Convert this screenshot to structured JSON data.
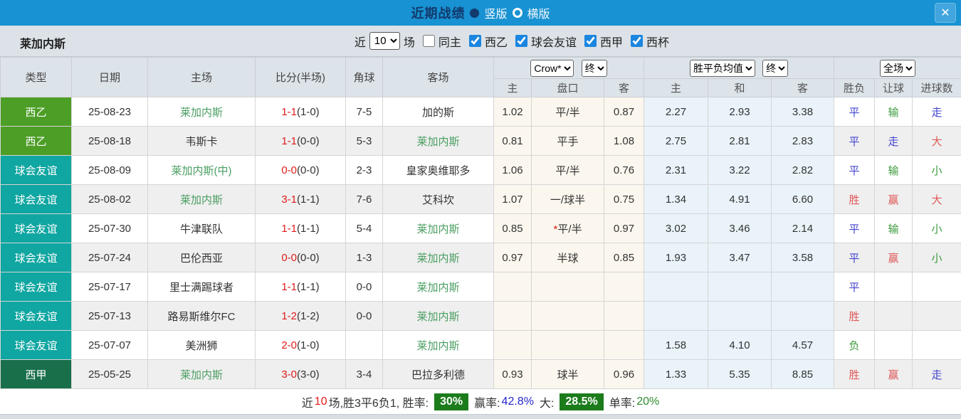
{
  "titlebar": {
    "title": "近期战绩",
    "radio_vertical": "竖版",
    "radio_horizontal": "横版",
    "close": "✕"
  },
  "filters": {
    "team": "莱加内斯",
    "near_label": "近",
    "matches_value": "10",
    "matches_unit": "场",
    "same_home_label": "同主",
    "league_xiyi": "西乙",
    "league_friendly": "球会友谊",
    "league_xijia": "西甲",
    "league_xibei": "西杯"
  },
  "table": {
    "headers": [
      "类型",
      "日期",
      "主场",
      "比分(半场)",
      "角球",
      "客场"
    ],
    "controls": {
      "odds_source": "Crow*",
      "final1": "终",
      "avg_label": "胜平负均值",
      "final2": "终",
      "scope": "全场"
    },
    "sub_headers": [
      "主",
      "盘口",
      "客",
      "主",
      "和",
      "客",
      "胜负",
      "让球",
      "进球数"
    ],
    "rows": [
      {
        "row_class": "",
        "type": "西乙",
        "type_class": "lg-xiyi",
        "date": "25-08-23",
        "home": "莱加内斯",
        "home_class": "t-green",
        "score": "1-1",
        "half": "(1-0)",
        "corner": "7-5",
        "away": "加的斯",
        "away_class": "",
        "hcap_home": "1.02",
        "hcap_star": "",
        "hcap": "平/半",
        "hcap_away": "0.87",
        "avg_home": "2.27",
        "avg_draw": "2.93",
        "avg_away": "3.38",
        "res_wdl": "平",
        "res_wdl_class": "c-blue",
        "res_hcap": "输",
        "res_hcap_class": "c-green",
        "res_goals": "走",
        "res_goals_class": "c-blue"
      },
      {
        "row_class": "alt",
        "type": "西乙",
        "type_class": "lg-xiyi",
        "date": "25-08-18",
        "home": "韦斯卡",
        "home_class": "",
        "score": "1-1",
        "half": "(0-0)",
        "corner": "5-3",
        "away": "莱加内斯",
        "away_class": "t-green",
        "hcap_home": "0.81",
        "hcap_star": "",
        "hcap": "平手",
        "hcap_away": "1.08",
        "avg_home": "2.75",
        "avg_draw": "2.81",
        "avg_away": "2.83",
        "res_wdl": "平",
        "res_wdl_class": "c-blue",
        "res_hcap": "走",
        "res_hcap_class": "c-blue",
        "res_goals": "大",
        "res_goals_class": "c-red"
      },
      {
        "row_class": "",
        "type": "球会友谊",
        "type_class": "lg-friend",
        "date": "25-08-09",
        "home": "莱加内斯(中)",
        "home_class": "t-green",
        "score": "0-0",
        "half": "(0-0)",
        "corner": "2-3",
        "away": "皇家奥维耶多",
        "away_class": "",
        "hcap_home": "1.06",
        "hcap_star": "",
        "hcap": "平/半",
        "hcap_away": "0.76",
        "avg_home": "2.31",
        "avg_draw": "3.22",
        "avg_away": "2.82",
        "res_wdl": "平",
        "res_wdl_class": "c-blue",
        "res_hcap": "输",
        "res_hcap_class": "c-green",
        "res_goals": "小",
        "res_goals_class": "c-green"
      },
      {
        "row_class": "alt",
        "type": "球会友谊",
        "type_class": "lg-friend",
        "date": "25-08-02",
        "home": "莱加内斯",
        "home_class": "t-green",
        "score": "3-1",
        "half": "(1-1)",
        "corner": "7-6",
        "away": "艾科坎",
        "away_class": "",
        "hcap_home": "1.07",
        "hcap_star": "",
        "hcap": "一/球半",
        "hcap_away": "0.75",
        "avg_home": "1.34",
        "avg_draw": "4.91",
        "avg_away": "6.60",
        "res_wdl": "胜",
        "res_wdl_class": "c-red",
        "res_hcap": "赢",
        "res_hcap_class": "c-red",
        "res_goals": "大",
        "res_goals_class": "c-red"
      },
      {
        "row_class": "",
        "type": "球会友谊",
        "type_class": "lg-friend",
        "date": "25-07-30",
        "home": "牛津联队",
        "home_class": "",
        "score": "1-1",
        "half": "(1-1)",
        "corner": "5-4",
        "away": "莱加内斯",
        "away_class": "t-green",
        "hcap_home": "0.85",
        "hcap_star": "*",
        "hcap": "平/半",
        "hcap_away": "0.97",
        "avg_home": "3.02",
        "avg_draw": "3.46",
        "avg_away": "2.14",
        "res_wdl": "平",
        "res_wdl_class": "c-blue",
        "res_hcap": "输",
        "res_hcap_class": "c-green",
        "res_goals": "小",
        "res_goals_class": "c-green"
      },
      {
        "row_class": "alt",
        "type": "球会友谊",
        "type_class": "lg-friend",
        "date": "25-07-24",
        "home": "巴伦西亚",
        "home_class": "",
        "score": "0-0",
        "half": "(0-0)",
        "corner": "1-3",
        "away": "莱加内斯",
        "away_class": "t-green",
        "hcap_home": "0.97",
        "hcap_star": "",
        "hcap": "半球",
        "hcap_away": "0.85",
        "avg_home": "1.93",
        "avg_draw": "3.47",
        "avg_away": "3.58",
        "res_wdl": "平",
        "res_wdl_class": "c-blue",
        "res_hcap": "赢",
        "res_hcap_class": "c-red",
        "res_goals": "小",
        "res_goals_class": "c-green"
      },
      {
        "row_class": "",
        "type": "球会友谊",
        "type_class": "lg-friend",
        "date": "25-07-17",
        "home": "里士满踢球者",
        "home_class": "",
        "score": "1-1",
        "half": "(1-1)",
        "corner": "0-0",
        "away": "莱加内斯",
        "away_class": "t-green",
        "hcap_home": "",
        "hcap_star": "",
        "hcap": "",
        "hcap_away": "",
        "avg_home": "",
        "avg_draw": "",
        "avg_away": "",
        "res_wdl": "平",
        "res_wdl_class": "c-blue",
        "res_hcap": "",
        "res_hcap_class": "",
        "res_goals": "",
        "res_goals_class": ""
      },
      {
        "row_class": "alt",
        "type": "球会友谊",
        "type_class": "lg-friend",
        "date": "25-07-13",
        "home": "路易斯维尔FC",
        "home_class": "",
        "score": "1-2",
        "half": "(1-2)",
        "corner": "0-0",
        "away": "莱加内斯",
        "away_class": "t-green",
        "hcap_home": "",
        "hcap_star": "",
        "hcap": "",
        "hcap_away": "",
        "avg_home": "",
        "avg_draw": "",
        "avg_away": "",
        "res_wdl": "胜",
        "res_wdl_class": "c-red",
        "res_hcap": "",
        "res_hcap_class": "",
        "res_goals": "",
        "res_goals_class": ""
      },
      {
        "row_class": "",
        "type": "球会友谊",
        "type_class": "lg-friend",
        "date": "25-07-07",
        "home": "美洲狮",
        "home_class": "",
        "score": "2-0",
        "half": "(1-0)",
        "corner": "",
        "away": "莱加内斯",
        "away_class": "t-green",
        "hcap_home": "",
        "hcap_star": "",
        "hcap": "",
        "hcap_away": "",
        "avg_home": "1.58",
        "avg_draw": "4.10",
        "avg_away": "4.57",
        "res_wdl": "负",
        "res_wdl_class": "c-green",
        "res_hcap": "",
        "res_hcap_class": "",
        "res_goals": "",
        "res_goals_class": ""
      },
      {
        "row_class": "alt",
        "type": "西甲",
        "type_class": "lg-xijia",
        "date": "25-05-25",
        "home": "莱加内斯",
        "home_class": "t-green",
        "score": "3-0",
        "half": "(3-0)",
        "corner": "3-4",
        "away": "巴拉多利德",
        "away_class": "",
        "hcap_home": "0.93",
        "hcap_star": "",
        "hcap": "球半",
        "hcap_away": "0.96",
        "avg_home": "1.33",
        "avg_draw": "5.35",
        "avg_away": "8.85",
        "res_wdl": "胜",
        "res_wdl_class": "c-red",
        "res_hcap": "赢",
        "res_hcap_class": "c-red",
        "res_goals": "走",
        "res_goals_class": "c-blue"
      }
    ]
  },
  "summary": {
    "near_label": "近",
    "count": "10",
    "record_text": "场,胜3平6负1, 胜率:",
    "win_rate": "30%",
    "win_odds_label": "赢率:",
    "win_odds_rate": "42.8%",
    "big_label": "大:",
    "big_rate": "28.5%",
    "single_label": "单率:",
    "single_rate": "20%"
  },
  "colors": {
    "topbar_blue": "#1892d2",
    "badge_xiyi": "#4d9e27",
    "badge_friendly": "#10a6a1",
    "badge_xijia": "#1a6f4b",
    "summary_badge_green": "#1c7c1c",
    "score_red": "#e01b1b",
    "focus_team_green": "#4a9e62"
  }
}
